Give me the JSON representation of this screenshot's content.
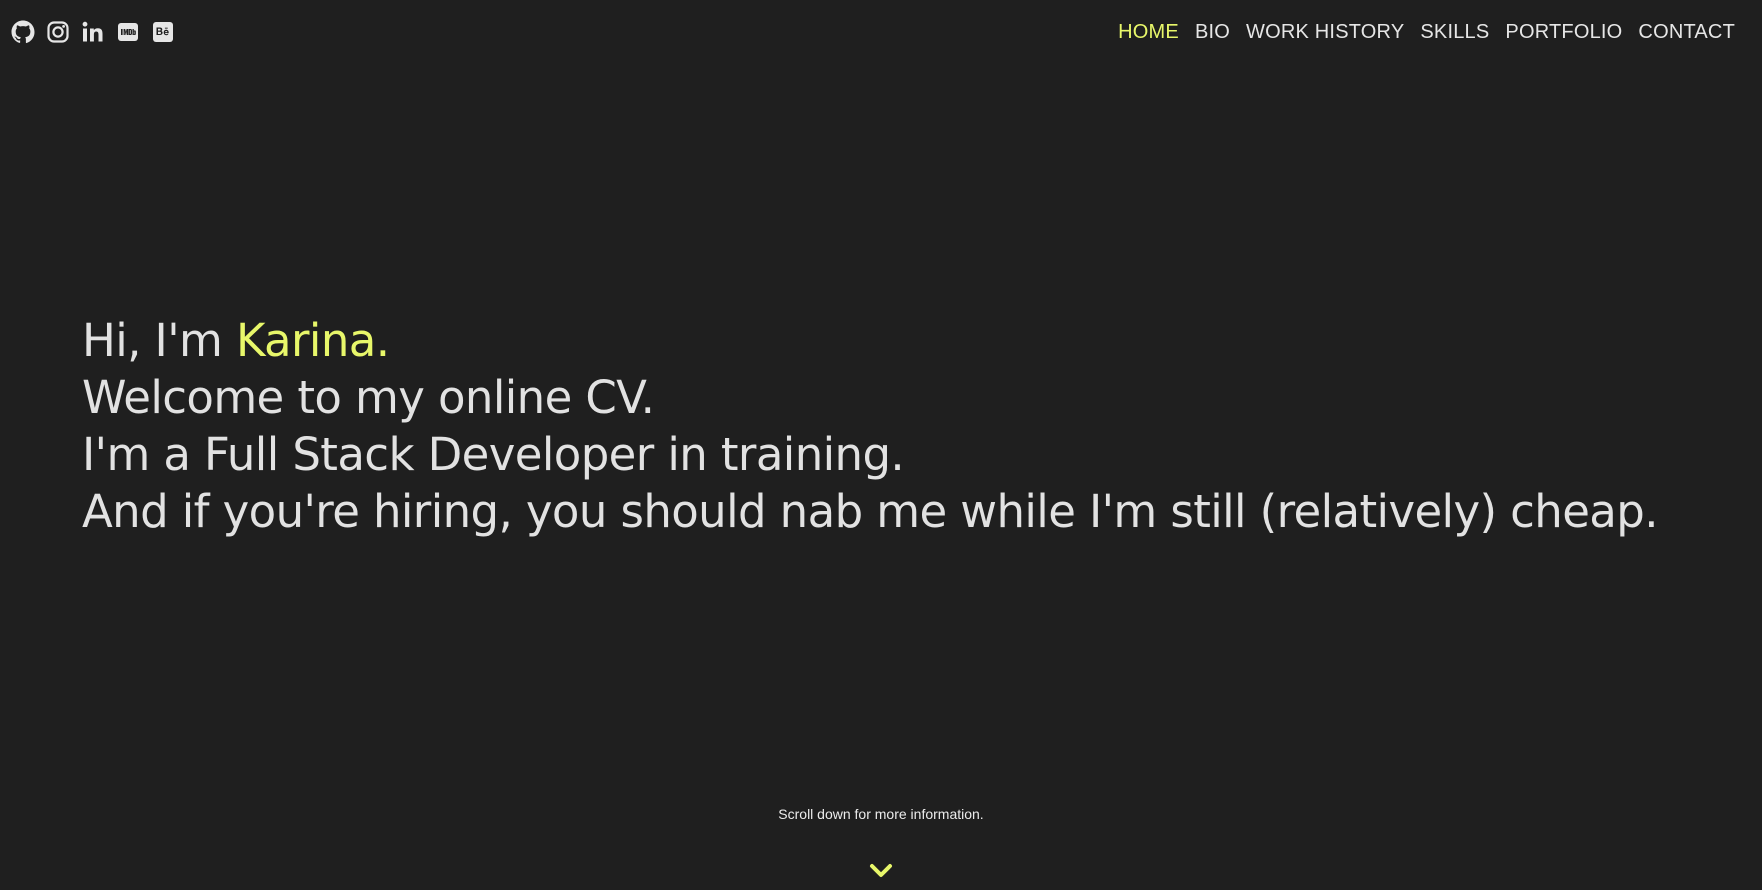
{
  "colors": {
    "background": "#1f1f1f",
    "text": "#e6e6e6",
    "accent": "#e8f76a"
  },
  "social": [
    {
      "icon": "github-icon"
    },
    {
      "icon": "instagram-icon"
    },
    {
      "icon": "linkedin-icon"
    },
    {
      "icon": "imdb-icon"
    },
    {
      "icon": "behance-icon"
    }
  ],
  "nav": {
    "items": [
      {
        "label": "HOME",
        "active": true
      },
      {
        "label": "BIO",
        "active": false
      },
      {
        "label": "WORK HISTORY",
        "active": false
      },
      {
        "label": "SKILLS",
        "active": false
      },
      {
        "label": "PORTFOLIO",
        "active": false
      },
      {
        "label": "CONTACT",
        "active": false
      }
    ]
  },
  "hero": {
    "greeting_prefix": "Hi, I'm ",
    "name": "Karina.",
    "line2": "Welcome to my online CV.",
    "line3": "I'm a Full Stack Developer in training.",
    "line4": "And if you're hiring, you should nab me while I'm still (relatively) cheap."
  },
  "scroll": {
    "hint": "Scroll down for more information.",
    "icon": "chevron-down-icon"
  }
}
